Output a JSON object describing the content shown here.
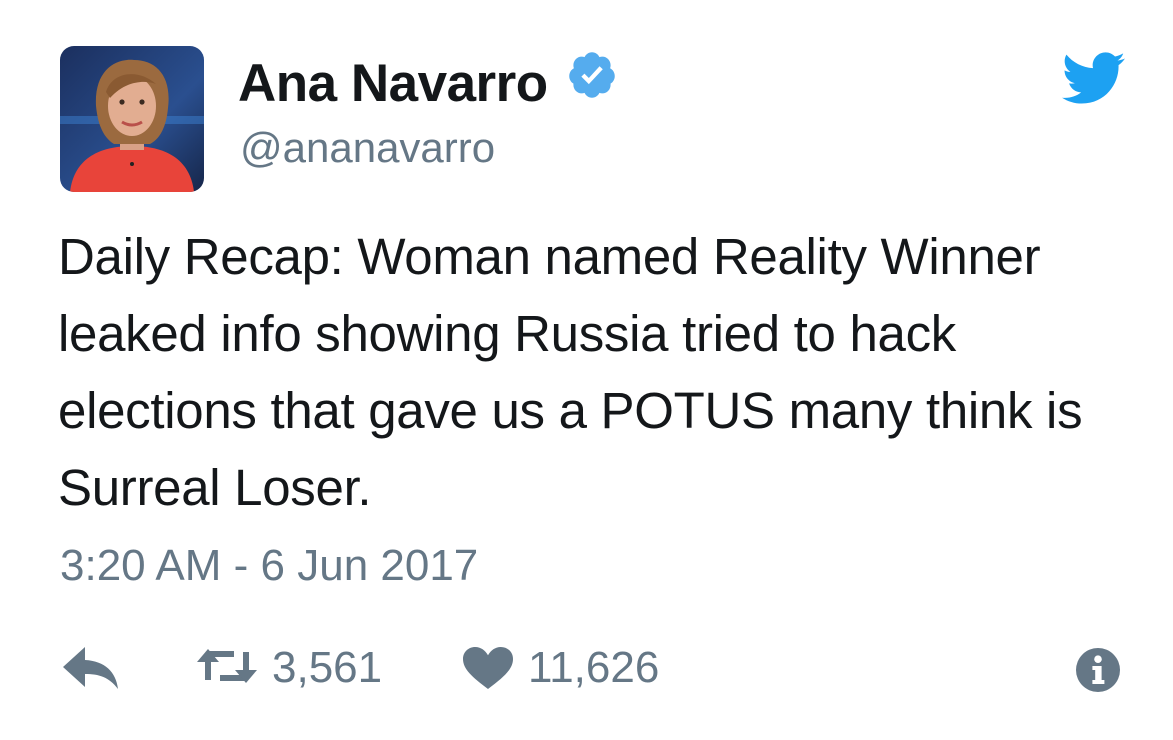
{
  "user": {
    "display_name": "Ana Navarro",
    "handle": "@ananavarro",
    "verified": true,
    "avatar_icon": "profile-photo"
  },
  "tweet": {
    "text": "Daily Recap: Woman named Reality Winner leaked info showing Russia tried to hack elections that gave us a POTUS many think is Surreal Loser.",
    "timestamp": "3:20 AM - 6 Jun 2017"
  },
  "actions": {
    "reply_icon": "reply-icon",
    "retweet_icon": "retweet-icon",
    "retweet_count": "3,561",
    "like_icon": "heart-icon",
    "like_count": "11,626",
    "info_icon": "info-icon"
  },
  "colors": {
    "text": "#14171a",
    "secondary": "#657786",
    "twitter_blue": "#1da1f2",
    "verified_blue": "#55acee"
  }
}
